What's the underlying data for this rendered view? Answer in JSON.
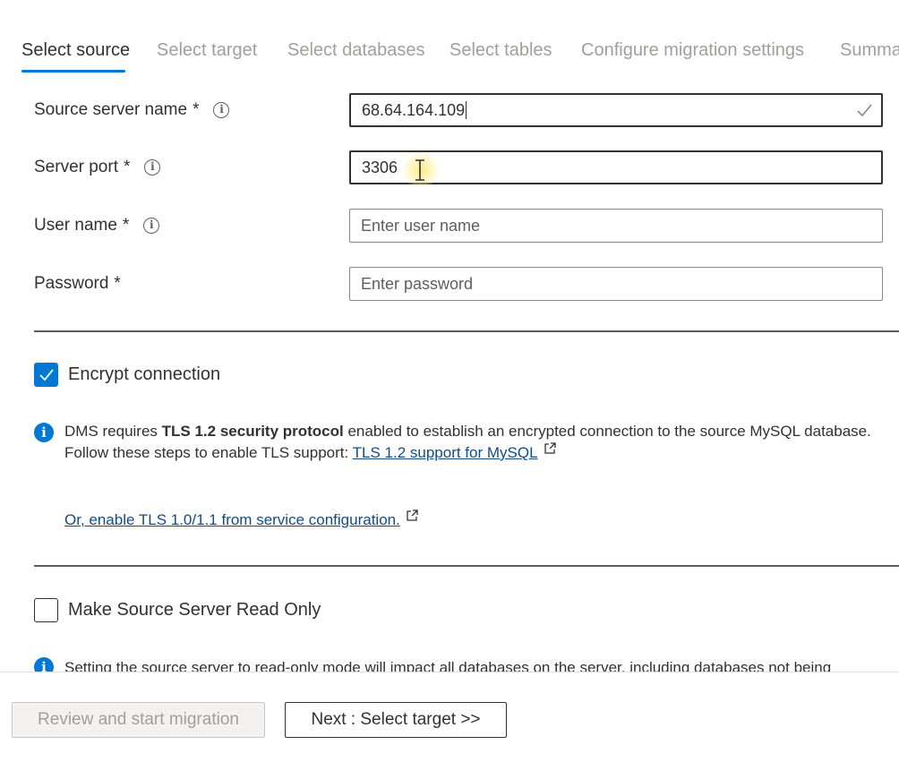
{
  "tabs": [
    {
      "label": "Select source",
      "active": true
    },
    {
      "label": "Select target",
      "active": false
    },
    {
      "label": "Select databases",
      "active": false
    },
    {
      "label": "Select tables",
      "active": false
    },
    {
      "label": "Configure migration settings",
      "active": false
    },
    {
      "label": "Summa",
      "active": false
    }
  ],
  "form": {
    "source_server": {
      "label": "Source server name",
      "required": "*",
      "value": "68.64.164.109"
    },
    "server_port": {
      "label": "Server port",
      "required": "*",
      "value": "3306"
    },
    "user_name": {
      "label": "User name",
      "required": "*",
      "placeholder": "Enter user name"
    },
    "password": {
      "label": "Password",
      "required": "*",
      "placeholder": "Enter password"
    }
  },
  "encrypt": {
    "label": "Encrypt connection",
    "checked": true,
    "note_prefix": "DMS requires ",
    "note_bold": "TLS 1.2 security protocol",
    "note_suffix": " enabled to establish an encrypted connection to the source MySQL database.",
    "note_line2": "Follow these steps to enable TLS support: ",
    "tls_link": "TLS 1.2 support for MySQL",
    "alt_link": "Or, enable TLS 1.0/1.1 from service configuration."
  },
  "readonly": {
    "label": "Make Source Server Read Only",
    "checked": false,
    "note": "Setting the source server to read-only mode will impact all databases on the server, including databases not being"
  },
  "footer": {
    "review_label": "Review and start migration",
    "next_label": "Next : Select target >>"
  },
  "colors": {
    "accent": "#0078d4",
    "link": "#0f4c8a"
  }
}
